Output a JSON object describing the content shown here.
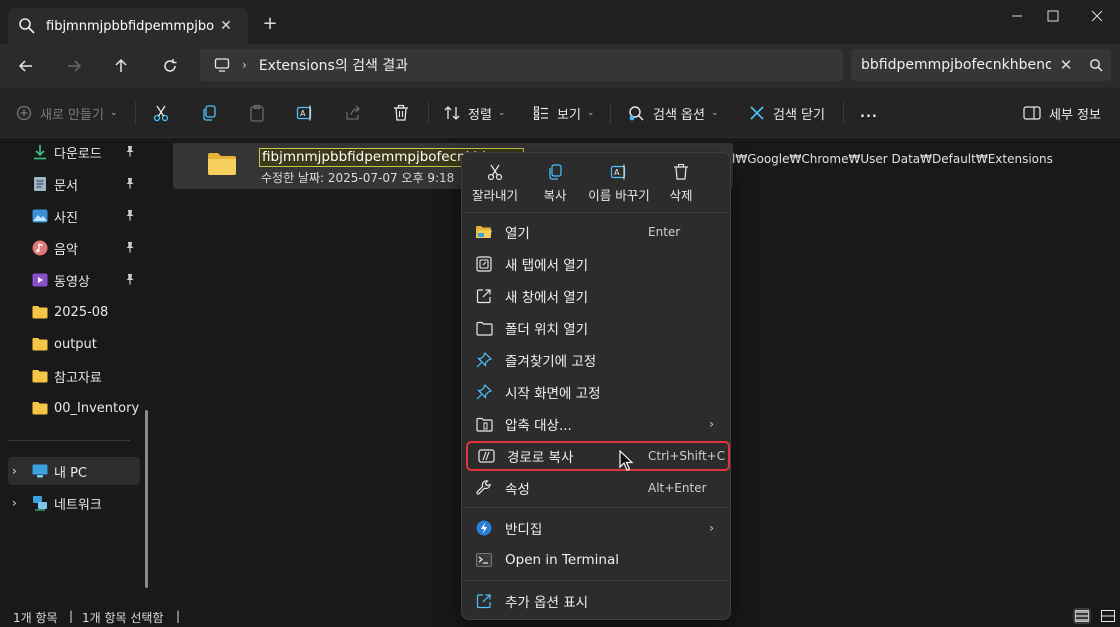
{
  "tab": {
    "title": "fibjmnmjpbbfidpemmpjbofecnkhbeno"
  },
  "address": {
    "path": "Extensions의 검색 결과"
  },
  "search": {
    "value": "bbfidpemmpjbofecnkhbeno"
  },
  "commandbar": {
    "new_label": "새로 만들기",
    "sort_label": "정렬",
    "view_label": "보기",
    "search_options_label": "검색 옵션",
    "close_search_label": "검색 닫기",
    "more_label": "...",
    "details_label": "세부 정보"
  },
  "sidebar": {
    "items": [
      {
        "label": "다운로드",
        "icon": "download-icon",
        "pinned": true
      },
      {
        "label": "문서",
        "icon": "document-icon",
        "pinned": true
      },
      {
        "label": "사진",
        "icon": "pictures-icon",
        "pinned": true
      },
      {
        "label": "음악",
        "icon": "music-icon",
        "pinned": true
      },
      {
        "label": "동영상",
        "icon": "video-icon",
        "pinned": true
      },
      {
        "label": "2025-08",
        "icon": "folder-icon"
      },
      {
        "label": "output",
        "icon": "folder-icon"
      },
      {
        "label": "참고자료",
        "icon": "folder-icon"
      },
      {
        "label": "00_Inventory",
        "icon": "folder-icon"
      }
    ],
    "this_pc": "내 PC",
    "network": "네트워크"
  },
  "file": {
    "name": "fibjmnmjpbbfidpemmpjbofecnkhbeno",
    "modified": "수정한 날짜: 2025-07-07 오후 9:18",
    "path_tail": "l₩Google₩Chrome₩User Data₩Default₩Extensions"
  },
  "context_menu": {
    "quick_actions": [
      "잘라내기",
      "복사",
      "이름 바꾸기",
      "삭제"
    ],
    "items": [
      {
        "label": "열기",
        "shortcut": "Enter",
        "icon": "open-folder-icon"
      },
      {
        "label": "새 탭에서 열기",
        "icon": "new-tab-icon"
      },
      {
        "label": "새 창에서 열기",
        "icon": "new-window-icon"
      },
      {
        "label": "폴더 위치 열기",
        "icon": "folder-outline-icon"
      },
      {
        "label": "즐겨찾기에 고정",
        "icon": "pin-icon"
      },
      {
        "label": "시작 화면에 고정",
        "icon": "pin-icon"
      },
      {
        "label": "압축 대상...",
        "icon": "zip-icon",
        "submenu": true
      },
      {
        "label": "경로로 복사",
        "shortcut": "Ctrl+Shift+C",
        "icon": "copy-path-icon",
        "highlighted": true
      },
      {
        "label": "속성",
        "shortcut": "Alt+Enter",
        "icon": "wrench-icon"
      },
      {
        "label": "반디집",
        "icon": "bandizip-icon",
        "submenu": true
      },
      {
        "label": "Open in Terminal",
        "icon": "terminal-icon"
      },
      {
        "label": "추가 옵션 표시",
        "icon": "more-options-icon"
      }
    ]
  },
  "status": {
    "count": "1개 항목",
    "separator": "|",
    "selected": "1개 항목 선택함",
    "separator2": "|"
  },
  "colors": {
    "accent": "#4cc2ff",
    "highlight_border": "#e0353d",
    "folder": "#f5c547"
  }
}
